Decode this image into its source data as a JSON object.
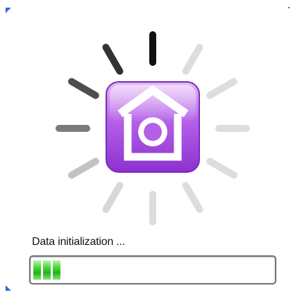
{
  "splash": {
    "status_text": "Data initialization ...",
    "progress_percent": 15,
    "progress_blocks_filled": 3,
    "app_icon": "home-camera-icon",
    "spinner_icon": "loading-spinner-icon"
  },
  "colors": {
    "accent_purple": "#a84fe0",
    "progress_green": "#2fc22a",
    "corner_blue": "#2f6fd1",
    "spinner_active": "#111111",
    "spinner_inactive": "#dcdcdc"
  }
}
